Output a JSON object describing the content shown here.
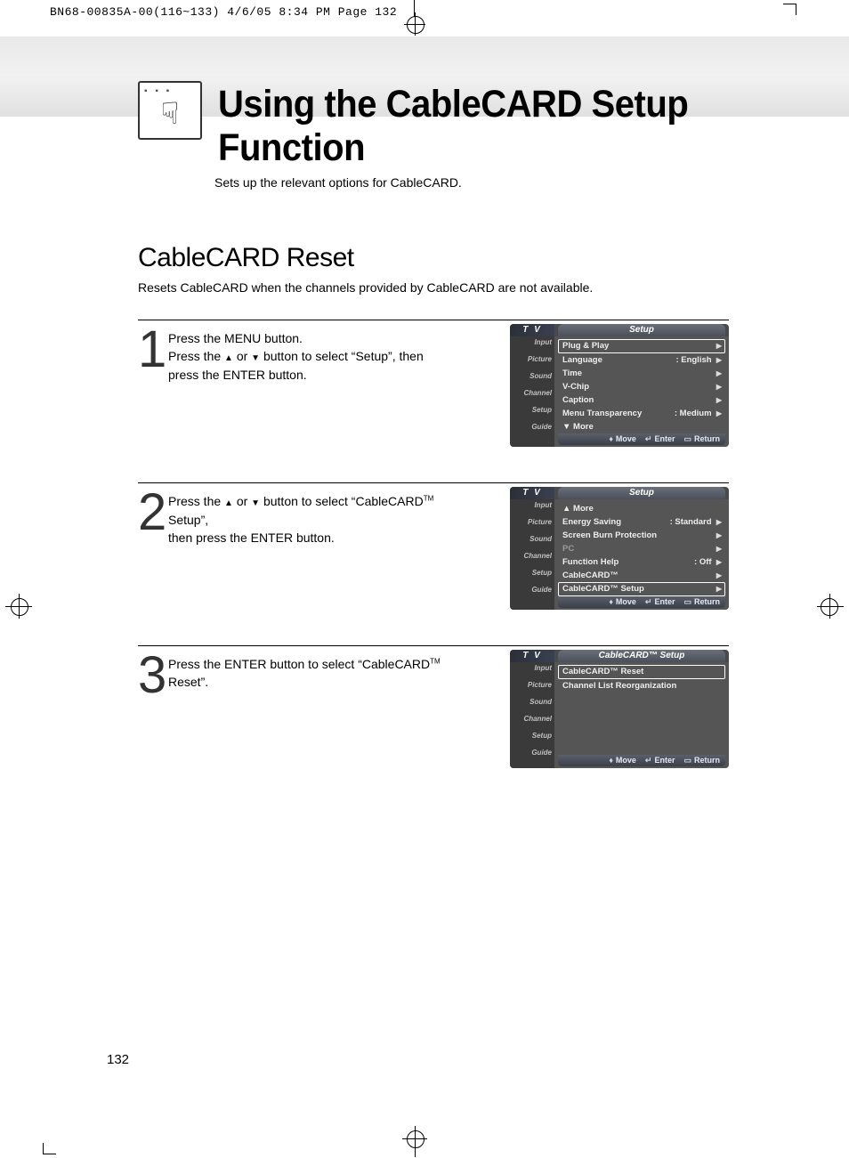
{
  "print_header": "BN68-00835A-00(116~133)  4/6/05  8:34 PM  Page 132",
  "main_title": "Using the CableCARD Setup Function",
  "subtitle": "Sets up the relevant options for CableCARD.",
  "section_title": "CableCARD Reset",
  "section_desc": "Resets CableCARD when the channels provided by CableCARD are not available.",
  "steps": {
    "s1": {
      "num": "1",
      "line1": "Press the MENU button.",
      "line2a": "Press the ",
      "line2b": " or ",
      "line2c": " button to select “Setup”, then",
      "line3": "press the ENTER button."
    },
    "s2": {
      "num": "2",
      "line1a": "Press the ",
      "line1b": " or ",
      "line1c": " button to select “CableCARD",
      "line1d": " Setup”,",
      "line2": "then press the ENTER button."
    },
    "s3": {
      "num": "3",
      "line1a": "Press the ENTER button to select “CableCARD",
      "line1b": " Reset”."
    }
  },
  "osd": {
    "tv": "T V",
    "side": [
      "Input",
      "Picture",
      "Sound",
      "Channel",
      "Setup",
      "Guide"
    ],
    "footer": {
      "move": "Move",
      "enter": "Enter",
      "return": "Return"
    },
    "screen1": {
      "title": "Setup",
      "rows": [
        {
          "label": "Plug & Play",
          "value": "",
          "sel": true,
          "arrow": true
        },
        {
          "label": "Language",
          "value": ": English",
          "arrow": true
        },
        {
          "label": "Time",
          "value": "",
          "arrow": true
        },
        {
          "label": "V-Chip",
          "value": "",
          "arrow": true
        },
        {
          "label": "Caption",
          "value": "",
          "arrow": true
        },
        {
          "label": "Menu Transparency",
          "value": ": Medium",
          "arrow": true
        },
        {
          "label": "▼ More",
          "value": "",
          "arrow": false
        }
      ]
    },
    "screen2": {
      "title": "Setup",
      "rows": [
        {
          "label": "▲ More",
          "value": "",
          "arrow": false
        },
        {
          "label": "Energy Saving",
          "value": ": Standard",
          "arrow": true
        },
        {
          "label": "Screen Burn Protection",
          "value": "",
          "arrow": true
        },
        {
          "label": "PC",
          "value": "",
          "arrow": true,
          "dim": true
        },
        {
          "label": "Function Help",
          "value": ": Off",
          "arrow": true
        },
        {
          "label": "CableCARD™",
          "value": "",
          "arrow": true
        },
        {
          "label": "CableCARD™ Setup",
          "value": "",
          "sel": true,
          "arrow": true
        }
      ]
    },
    "screen3": {
      "title": "CableCARD™ Setup",
      "rows": [
        {
          "label": "CableCARD™ Reset",
          "value": "",
          "sel": true,
          "arrow": false
        },
        {
          "label": "Channel List Reorganization",
          "value": "",
          "arrow": false
        }
      ]
    }
  },
  "page_number": "132"
}
